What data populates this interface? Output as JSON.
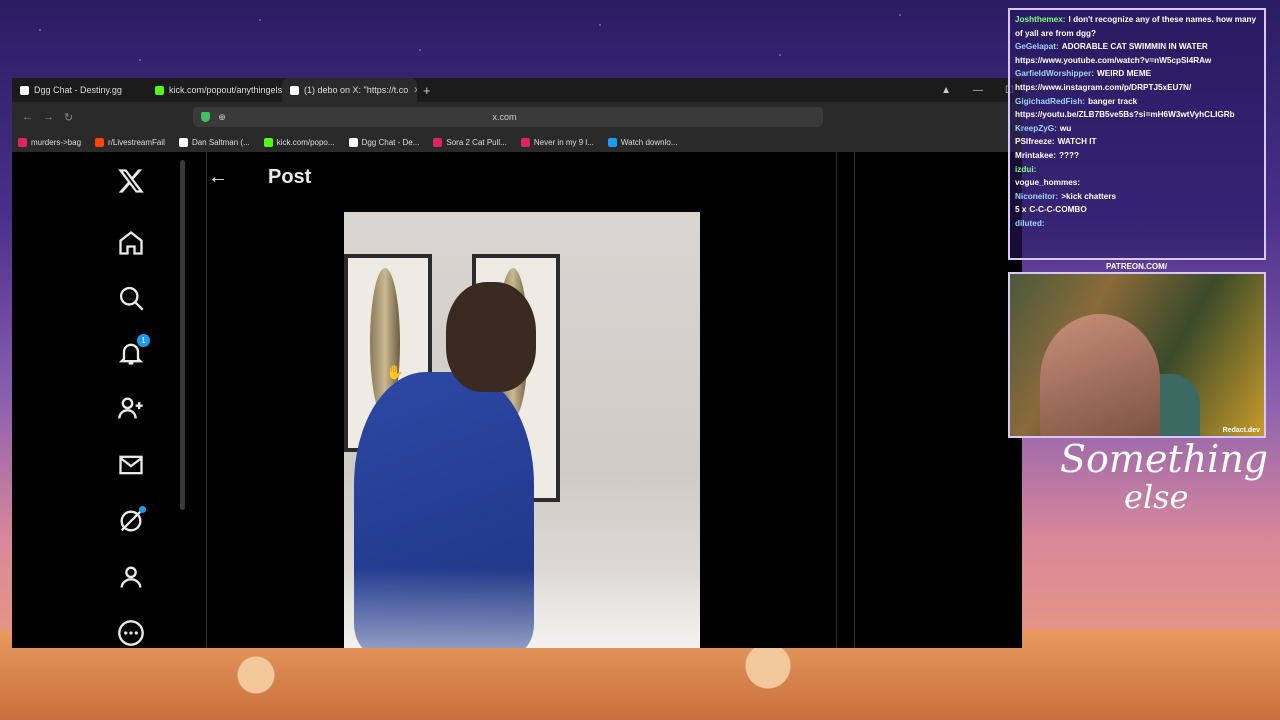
{
  "browser": {
    "tabs": [
      {
        "label": "Dgg Chat - Destiny.gg",
        "favicon_color": "#ffffff",
        "active": false
      },
      {
        "label": "kick.com/popout/anythingelse/chat",
        "favicon_color": "#53fc18",
        "active": false
      },
      {
        "label": "(1) debo on X: \"https://t.co",
        "favicon_color": "#ffffff",
        "active": true
      }
    ],
    "url": "x.com",
    "bookmarks": [
      {
        "label": "murders->bag",
        "color": "#e0245e"
      },
      {
        "label": "r/LivestreamFail",
        "color": "#ff4500"
      },
      {
        "label": "Dan Saltman (...",
        "color": "#ffffff"
      },
      {
        "label": "kick.com/popo...",
        "color": "#53fc18"
      },
      {
        "label": "Dgg Chat - De...",
        "color": "#ffffff"
      },
      {
        "label": "Sora 2 Cat Pull...",
        "color": "#e0245e"
      },
      {
        "label": "Never in my 9 l...",
        "color": "#e0245e"
      },
      {
        "label": "Watch downlo...",
        "color": "#1d9bf0"
      }
    ]
  },
  "x": {
    "header_title": "Post",
    "notification_count": "1"
  },
  "chat": {
    "messages": [
      {
        "user": "Joshthemex:",
        "user_color": "#7fff7f",
        "text": "I don't recognize any of these names. how many of yall are from dgg?"
      },
      {
        "user": "GeGelapat:",
        "user_color": "#9fd3ff",
        "text": "ADORABLE CAT SWIMMIN IN WATER https://www.youtube.com/watch?v=nW5cpSl4RAw"
      },
      {
        "user": "GarfieldWorshipper:",
        "user_color": "#9fd3ff",
        "text": "WEIRD MEME https://www.instagram.com/p/DRPTJ5xEU7N/"
      },
      {
        "user": "GigichadRedFish:",
        "user_color": "#9fd3ff",
        "text": "banger track https://youtu.be/ZLB7B5ve5Bs?si=mH6W3wtVyhCLIGRb"
      },
      {
        "user": "KreepZyG:",
        "user_color": "#9fd3ff",
        "text": "wu"
      },
      {
        "user": "PSIfreeze:",
        "user_color": "#ffffff",
        "text": "WATCH IT"
      },
      {
        "user": "Mrintakee:",
        "user_color": "#ffffff",
        "text": "????"
      },
      {
        "user": "izdui:",
        "user_color": "#7fff7f",
        "text": ""
      },
      {
        "user": "vogue_hommes:",
        "user_color": "#ffffff",
        "text": ""
      },
      {
        "user": "Niconeitor:",
        "user_color": "#9fd3ff",
        "text": ">kick chatters"
      },
      {
        "user": "5 x",
        "user_color": "#ffffff",
        "text": "C-C-C-COMBO"
      },
      {
        "user": "diluted:",
        "user_color": "#9fd3ff",
        "text": ""
      }
    ]
  },
  "overlay": {
    "cam_label": "PATREON.COM/",
    "cam_credit": "Redact.dev",
    "brand_line1": "Something",
    "brand_line2": "else"
  }
}
